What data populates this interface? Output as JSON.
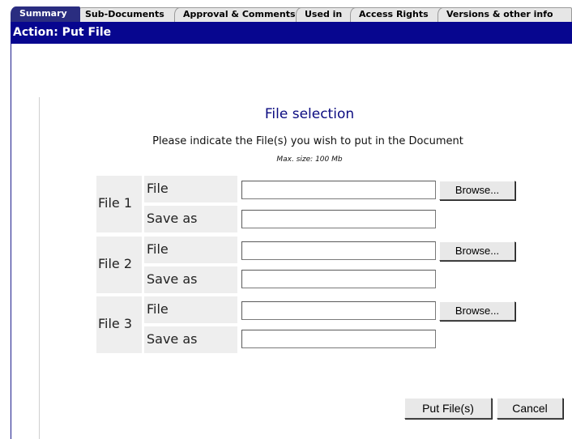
{
  "tabs": [
    {
      "label": "Summary",
      "active": true
    },
    {
      "label": "Sub-Documents",
      "active": false
    },
    {
      "label": "Approval & Comments",
      "active": false
    },
    {
      "label": "Used in",
      "active": false
    },
    {
      "label": "Access Rights",
      "active": false
    },
    {
      "label": "Versions & other info",
      "active": false
    }
  ],
  "action": "Action: Put File",
  "form": {
    "title": "File selection",
    "instruction": "Please indicate the File(s) you wish to put in the Document",
    "max_size": "Max. size: 100 Mb",
    "rows": [
      {
        "label": "File 1",
        "file_label": "File",
        "saveas_label": "Save as",
        "file_value": "",
        "saveas_value": "",
        "browse_label": "Browse..."
      },
      {
        "label": "File 2",
        "file_label": "File",
        "saveas_label": "Save as",
        "file_value": "",
        "saveas_value": "",
        "browse_label": "Browse..."
      },
      {
        "label": "File 3",
        "file_label": "File",
        "saveas_label": "Save as",
        "file_value": "",
        "saveas_value": "",
        "browse_label": "Browse..."
      }
    ],
    "put_label": "Put File(s)",
    "cancel_label": "Cancel"
  },
  "colors": {
    "action_bar": "#07068f",
    "active_tab": "#2a2d80",
    "title": "#0a0a80"
  }
}
